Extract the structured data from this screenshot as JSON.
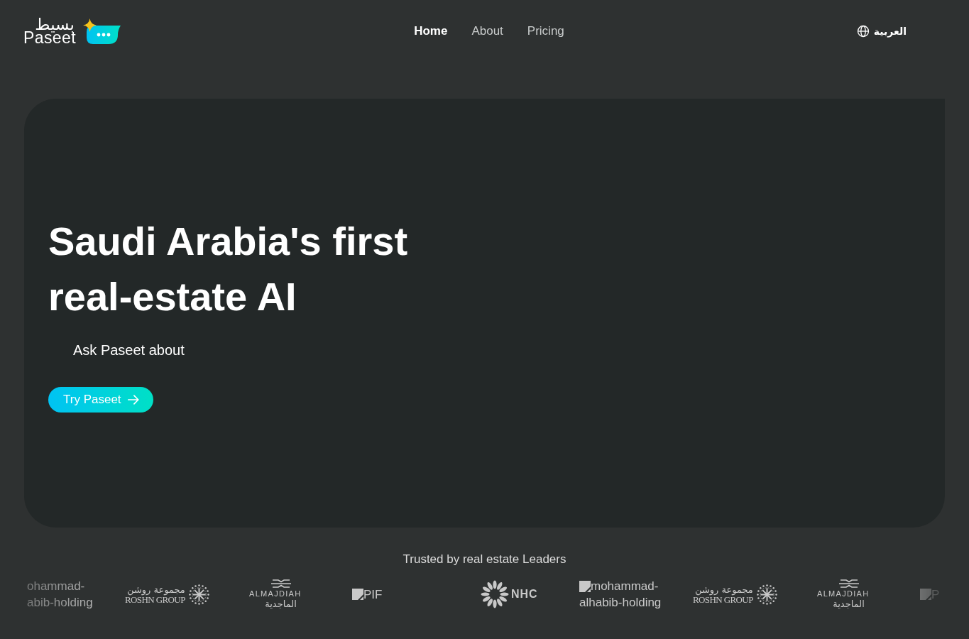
{
  "header": {
    "logo": {
      "arabic": "بسيط",
      "latin": "Paseet"
    },
    "nav": [
      {
        "label": "Home",
        "selected": true
      },
      {
        "label": "About",
        "selected": false
      },
      {
        "label": "Pricing",
        "selected": false
      }
    ],
    "language_button": {
      "label": "العربية"
    }
  },
  "hero": {
    "title": "Saudi Arabia's first real-estate AI",
    "subtitle": "Ask Paseet about",
    "cta": {
      "label": "Try Paseet"
    }
  },
  "partners": {
    "heading": "Trusted by real estate Leaders",
    "logos": [
      {
        "kind": "alt-text",
        "lines": [
          "ohammad-",
          "abib-holding"
        ]
      },
      {
        "kind": "roshn",
        "arabic": "مجموعة روشن",
        "latin": "ROSHN GROUP"
      },
      {
        "kind": "almajdiah",
        "latin": "ALMAJDIAH",
        "arabic": "الماجدية"
      },
      {
        "kind": "broken-image",
        "lines": [
          "PIF"
        ]
      },
      {
        "kind": "nhc",
        "label": "NHC"
      },
      {
        "kind": "broken-image",
        "lines": [
          "mohammad-",
          "alhabib-holding"
        ]
      },
      {
        "kind": "roshn",
        "arabic": "مجموعة روشن",
        "latin": "ROSHN GROUP"
      },
      {
        "kind": "almajdiah",
        "latin": "ALMAJDIAH",
        "arabic": "الماجدية"
      },
      {
        "kind": "broken-image",
        "lines": [
          "P"
        ]
      }
    ]
  }
}
